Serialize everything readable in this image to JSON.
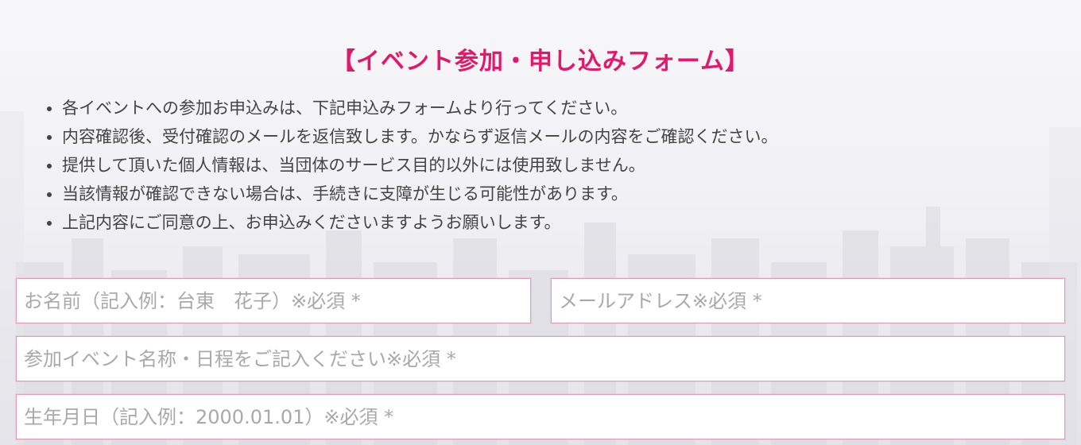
{
  "form": {
    "title": "【イベント参加・申し込みフォーム】",
    "notes": [
      "各イベントへの参加お申込みは、下記申込みフォームより行ってください。",
      "内容確認後、受付確認のメールを返信致します。かならず返信メールの内容をご確認ください。",
      "提供して頂いた個人情報は、当団体のサービス目的以外には使用致しません。",
      "当該情報が確認できない場合は、手続きに支障が生じる可能性があります。",
      "上記内容にご同意の上、お申込みくださいますようお願いします。"
    ],
    "fields": {
      "name": {
        "placeholder": "お名前（記入例：台東　花子）※必須 *",
        "value": ""
      },
      "email": {
        "placeholder": "メールアドレス※必須 *",
        "value": ""
      },
      "event": {
        "placeholder": "参加イベント名称・日程をご記入ください※必須 *",
        "value": ""
      },
      "birthdate": {
        "placeholder": "生年月日（記入例：2000.01.01）※必須 *",
        "value": ""
      }
    }
  },
  "colors": {
    "title": "#e3186b",
    "field_border": "#e59ab8",
    "text": "#444444",
    "placeholder": "#a9a9a9"
  }
}
